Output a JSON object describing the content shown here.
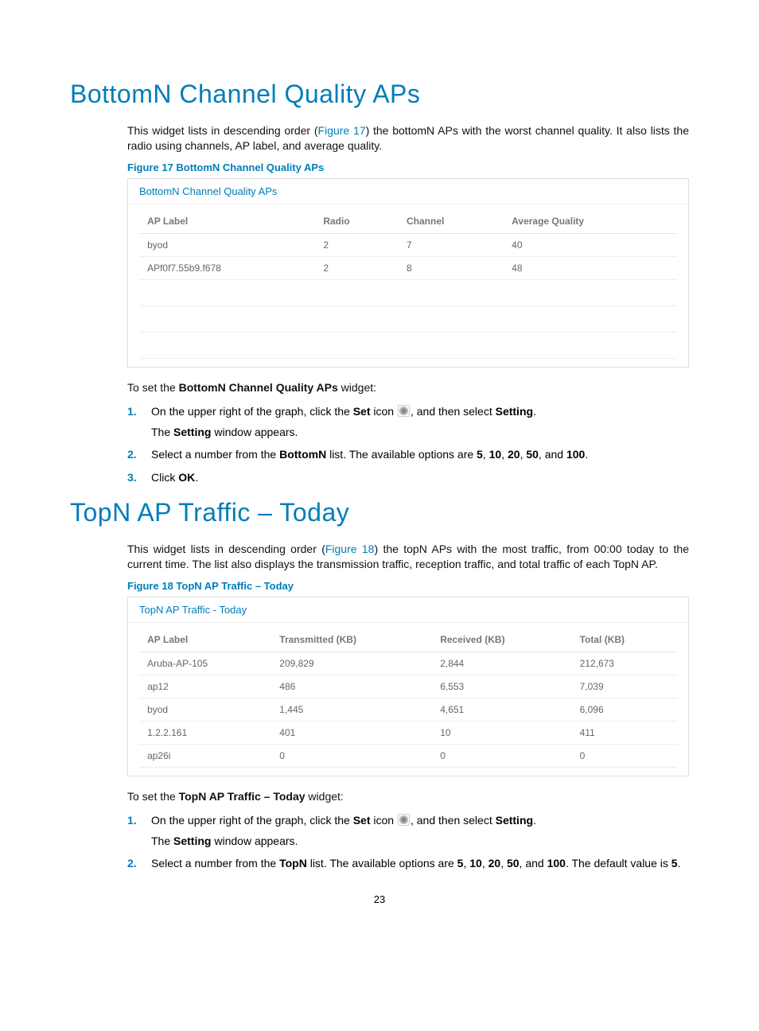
{
  "section1": {
    "title": "BottomN Channel Quality APs",
    "intro_a": "This widget lists in descending order (",
    "intro_link": "Figure 17",
    "intro_b": ") the bottomN APs with the worst channel quality. It also lists the radio using channels, AP label, and average quality.",
    "figure_caption": "Figure 17 BottomN Channel Quality APs",
    "widget_title": "BottomN Channel Quality APs",
    "headers": {
      "c1": "AP Label",
      "c2": "Radio",
      "c3": "Channel",
      "c4": "Average Quality"
    },
    "rows": [
      {
        "c1": "byod",
        "c2": "2",
        "c3": "7",
        "c4": "40"
      },
      {
        "c1": "APf0f7.55b9.f678",
        "c2": "2",
        "c3": "8",
        "c4": "48"
      }
    ],
    "preset": "To set the ",
    "preset_bold": "BottomN Channel Quality APs",
    "preset_tail": " widget:",
    "step1_a": "On the upper right of the graph, click the ",
    "step1_b": "Set",
    "step1_c": " icon ",
    "step1_d": ", and then select ",
    "step1_e": "Setting",
    "step1_f": ".",
    "step1_sub_a": "The ",
    "step1_sub_b": "Setting",
    "step1_sub_c": " window appears.",
    "step2_a": "Select a number from the ",
    "step2_b": "BottomN",
    "step2_c": " list. The available options are ",
    "step2_o1": "5",
    "step2_s1": ", ",
    "step2_o2": "10",
    "step2_s2": ", ",
    "step2_o3": "20",
    "step2_s3": ", ",
    "step2_o4": "50",
    "step2_s4": ", and ",
    "step2_o5": "100",
    "step2_tail": ".",
    "step3_a": "Click ",
    "step3_b": "OK",
    "step3_c": "."
  },
  "section2": {
    "title": "TopN AP Traffic – Today",
    "intro_a": "This widget lists in descending order (",
    "intro_link": "Figure 18",
    "intro_b": ") the topN APs with the most traffic, from 00:00 today to the current time. The list also displays the transmission traffic, reception traffic, and total traffic of each TopN AP.",
    "figure_caption": "Figure 18 TopN AP Traffic – Today",
    "widget_title": "TopN AP Traffic - Today",
    "headers": {
      "c1": "AP Label",
      "c2": "Transmitted (KB)",
      "c3": "Received (KB)",
      "c4": "Total (KB)"
    },
    "rows": [
      {
        "c1": "Aruba-AP-105",
        "c2": "209,829",
        "c3": "2,844",
        "c4": "212,673"
      },
      {
        "c1": "ap12",
        "c2": "486",
        "c3": "6,553",
        "c4": "7,039"
      },
      {
        "c1": "byod",
        "c2": "1,445",
        "c3": "4,651",
        "c4": "6,096"
      },
      {
        "c1": "1.2.2.161",
        "c2": "401",
        "c3": "10",
        "c4": "411"
      },
      {
        "c1": "ap26i",
        "c2": "0",
        "c3": "0",
        "c4": "0"
      }
    ],
    "preset": "To set the ",
    "preset_bold": "TopN AP Traffic – Today",
    "preset_tail": " widget:",
    "step1_a": "On the upper right of the graph, click the ",
    "step1_b": "Set",
    "step1_c": " icon ",
    "step1_d": ", and then select ",
    "step1_e": "Setting",
    "step1_f": ".",
    "step1_sub_a": "The ",
    "step1_sub_b": "Setting",
    "step1_sub_c": " window appears.",
    "step2_a": "Select a number from the ",
    "step2_b": "TopN",
    "step2_c": " list. The available options are ",
    "step2_o1": "5",
    "step2_s1": ", ",
    "step2_o2": "10",
    "step2_s2": ", ",
    "step2_o3": "20",
    "step2_s3": ", ",
    "step2_o4": "50",
    "step2_s4": ", and ",
    "step2_o5": "100",
    "step2_tail": ". The default value is ",
    "step2_def": "5",
    "step2_end": "."
  },
  "page_number": "23",
  "step_numbers": {
    "n1": "1.",
    "n2": "2.",
    "n3": "3."
  }
}
